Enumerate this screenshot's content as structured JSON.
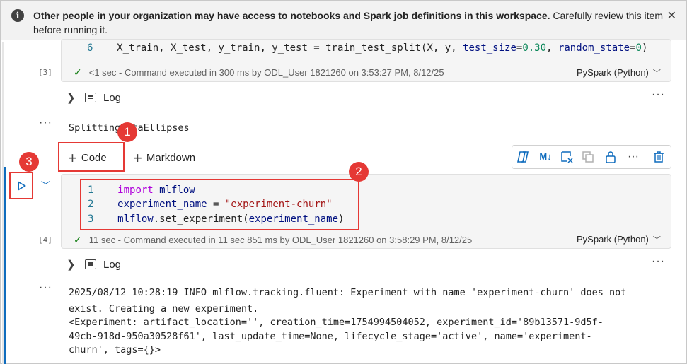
{
  "banner": {
    "bold_text": "Other people in your organization may have access to notebooks and Spark job definitions in this workspace.",
    "rest_text": " Carefully review this item before running it.",
    "info_icon": "info-icon",
    "close_icon": "close-icon",
    "close_glyph": "✕"
  },
  "cell3": {
    "line_number": "6",
    "code": {
      "a": "X_train, X_test, y_train, y_test = train_test_split(X, y, ",
      "k1": "test_size",
      "eq1": "=",
      "v1": "0.30",
      "comma": ", ",
      "k2": "random_state",
      "eq2": "=",
      "v2": "0",
      "close": ")"
    },
    "cell_number": "[3]",
    "exec_text": "<1 sec - Command executed in 300 ms by ODL_User 1821260 on 3:53:27 PM, 8/12/25",
    "language": "PySpark (Python)"
  },
  "log1": {
    "label": "Log"
  },
  "markdown_output": "SplittingDataEllipses",
  "toolbar": {
    "code_label": "Code",
    "markdown_label": "Markdown",
    "plus_glyph": "+",
    "tools": [
      "copilot-icon",
      "markdown-toggle-icon",
      "clear-output-icon",
      "copy-icon",
      "lock-icon",
      "more-icon",
      "delete-icon"
    ],
    "ml_glyph": "M↓",
    "more_glyph": "···"
  },
  "cell4": {
    "lines": [
      {
        "n": "1",
        "kw": "import",
        "rest": " mlflow"
      },
      {
        "n": "2",
        "var": "experiment_name",
        "eq": " = ",
        "str": "\"experiment-churn\""
      },
      {
        "n": "3",
        "a": "mlflow",
        "b": ".set_experiment(",
        "c": "experiment_name",
        "d": ")"
      }
    ],
    "cell_number": "[4]",
    "exec_text": "11 sec - Command executed in 11 sec 851 ms by ODL_User 1821260 on 3:58:29 PM, 8/12/25",
    "language": "PySpark (Python)"
  },
  "log2": {
    "label": "Log"
  },
  "output_lines": [
    "2025/08/12 10:28:19 INFO mlflow.tracking.fluent: Experiment with name 'experiment-churn' does not",
    "exist. Creating a new experiment.",
    "<Experiment: artifact_location='', creation_time=1754994504052, experiment_id='89b13571-9d5f-",
    "49cb-918d-950a30528f61', last_update_time=None, lifecycle_stage='active', name='experiment-",
    "churn', tags={}>"
  ],
  "callouts": [
    "1",
    "2",
    "3"
  ],
  "glyphs": {
    "check": "✓",
    "chev_right": "❯",
    "chev_down": "﹀",
    "dots": "···"
  }
}
